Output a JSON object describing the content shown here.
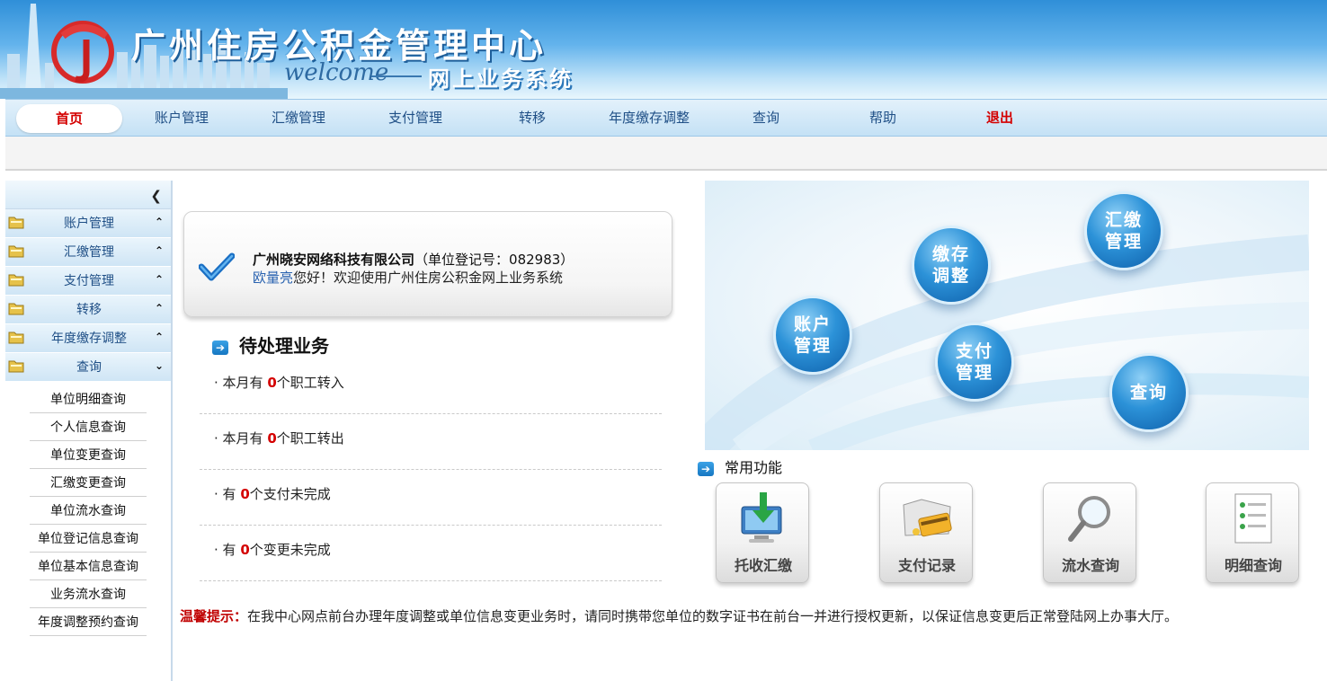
{
  "banner": {
    "title": "广州住房公积金管理中心",
    "welcome": "welcome",
    "subtitle": "网上业务系统"
  },
  "nav": {
    "items": [
      {
        "label": "首页",
        "active": true
      },
      {
        "label": "账户管理"
      },
      {
        "label": "汇缴管理"
      },
      {
        "label": "支付管理"
      },
      {
        "label": "转移"
      },
      {
        "label": "年度缴存调整"
      },
      {
        "label": "查询"
      },
      {
        "label": "帮助"
      },
      {
        "label": "退出"
      }
    ]
  },
  "sidebar": {
    "groups": [
      {
        "label": "账户管理"
      },
      {
        "label": "汇缴管理"
      },
      {
        "label": "支付管理"
      },
      {
        "label": "转移"
      },
      {
        "label": "年度缴存调整"
      },
      {
        "label": "查询"
      }
    ],
    "query_items": [
      "单位明细查询",
      "个人信息查询",
      "单位变更查询",
      "汇缴变更查询",
      "单位流水查询",
      "单位登记信息查询",
      "单位基本信息查询",
      "业务流水查询",
      "年度调整预约查询"
    ]
  },
  "info": {
    "company": "广州晓安网络科技有限公司",
    "reg_prefix": "（单位登记号：",
    "reg_no": "082983",
    "reg_suffix": "）",
    "user": "欧量亮",
    "greeting": "您好！欢迎使用广州住房公积金网上业务系统"
  },
  "pending": {
    "title": "待处理业务",
    "rows": [
      {
        "prefix": "· 本月有 ",
        "num": "0",
        "suffix": "个职工转入"
      },
      {
        "prefix": "· 本月有 ",
        "num": "0",
        "suffix": "个职工转出"
      },
      {
        "prefix": "· 有 ",
        "num": "0",
        "suffix": "个支付未完成"
      },
      {
        "prefix": "· 有 ",
        "num": "0",
        "suffix": "个变更未完成"
      }
    ]
  },
  "diagram": {
    "bubbles": [
      {
        "line1": "汇缴",
        "line2": "管理"
      },
      {
        "line1": "缴存",
        "line2": "调整"
      },
      {
        "line1": "账户",
        "line2": "管理"
      },
      {
        "line1": "支付",
        "line2": "管理"
      },
      {
        "line1": "查询",
        "line2": ""
      }
    ]
  },
  "common": {
    "title": "常用功能",
    "buttons": [
      "托收汇缴",
      "支付记录",
      "流水查询",
      "明细查询"
    ]
  },
  "tip": {
    "label": "温馨提示：",
    "text": "在我中心网点前台办理年度调整或单位信息变更业务时，请同时携带您单位的数字证书在前台一并进行授权更新，以保证信息变更后正常登陆网上办事大厅。"
  }
}
